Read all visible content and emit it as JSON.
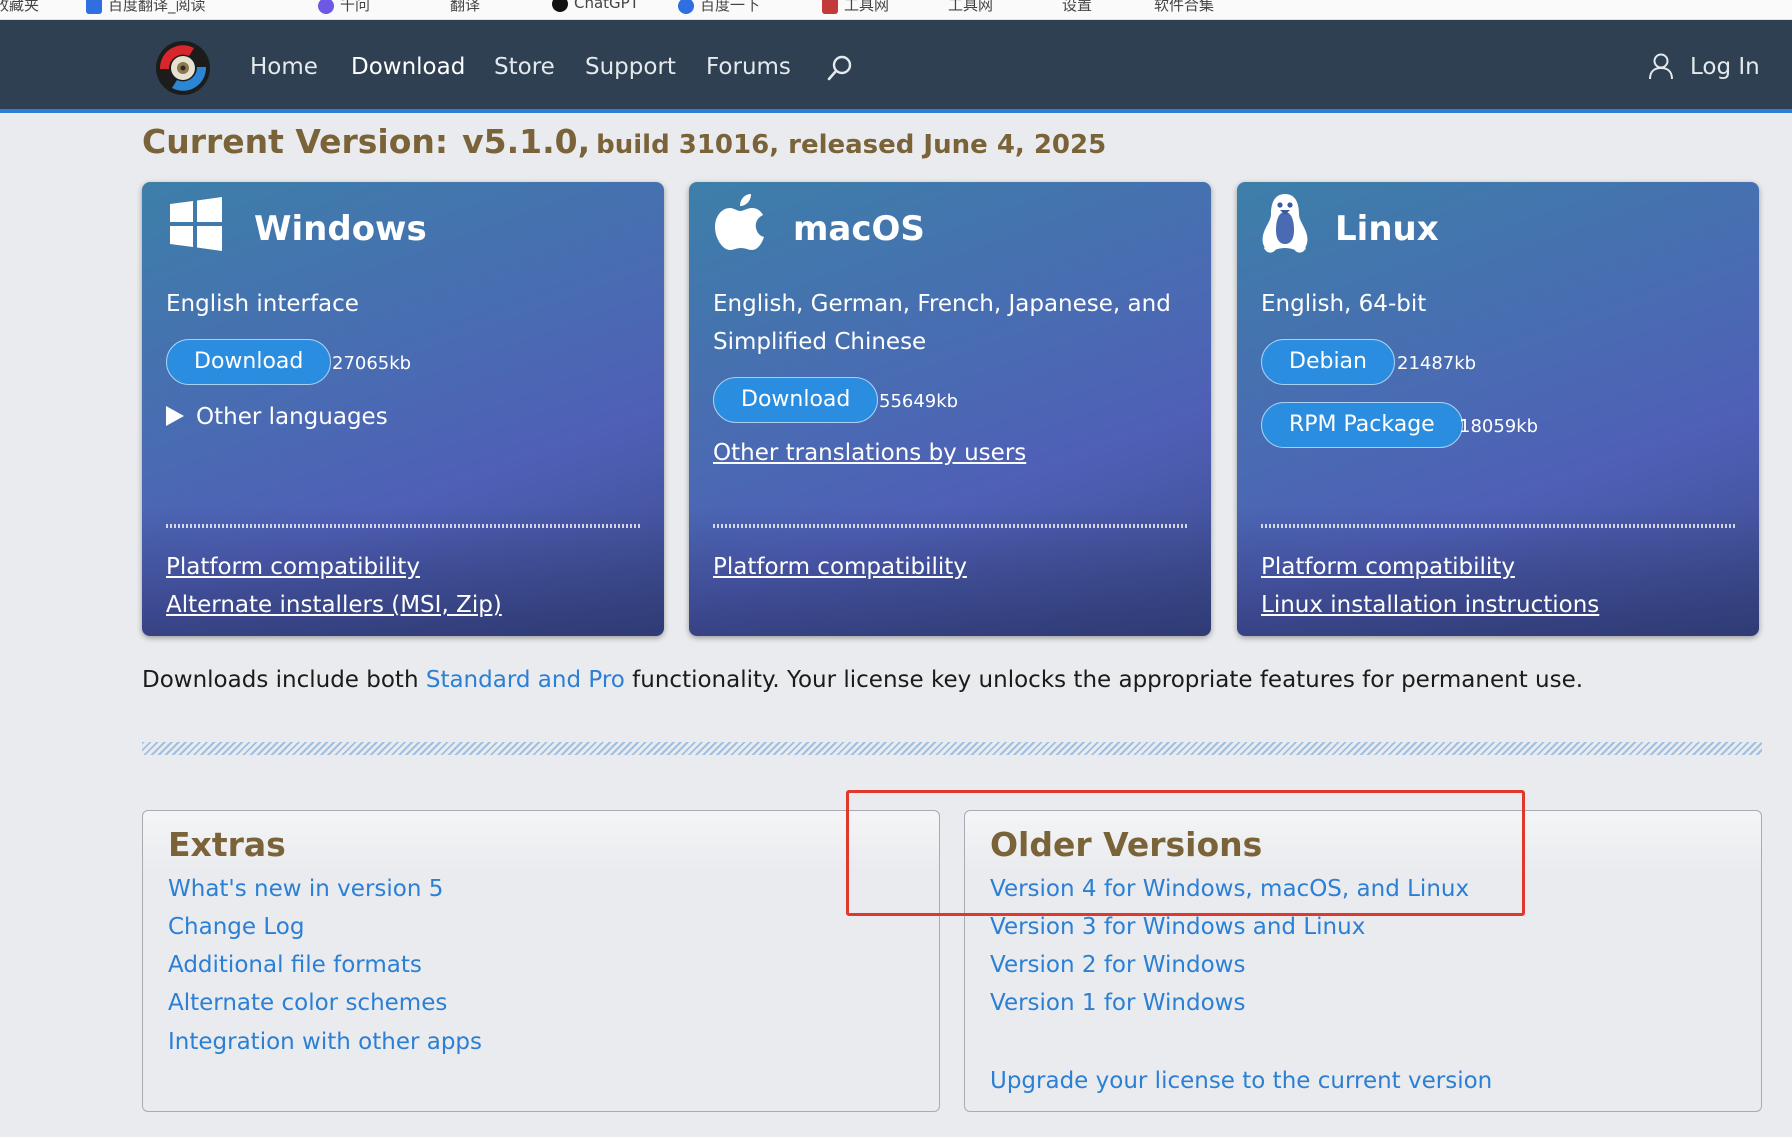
{
  "bookmarks": [
    {
      "label": "收藏夹",
      "icon": "folder-icon",
      "color": "#4a4a4a"
    },
    {
      "label": "百度翻译_阅读",
      "icon": "baidu-translate-icon",
      "color": "#2f6fe0"
    },
    {
      "label": "千问",
      "icon": "qwen-icon",
      "color": "#6b59e6"
    },
    {
      "label": "翻译",
      "icon": "translate-icon",
      "color": "#444444"
    },
    {
      "label": "ChatGPT",
      "icon": "chatgpt-icon",
      "color": "#111111"
    },
    {
      "label": "百度一下",
      "icon": "baidu-icon",
      "color": "#2f6fe0"
    },
    {
      "label": "工具网",
      "icon": "tool-site-icon",
      "color": "#c23a3a"
    },
    {
      "label": "工具网",
      "icon": "web-icon",
      "color": "#777777"
    },
    {
      "label": "设置",
      "icon": "settings-icon",
      "color": "#777777"
    },
    {
      "label": "软件合集",
      "icon": "software-icon",
      "color": "#777777"
    }
  ],
  "nav": {
    "items": [
      "Home",
      "Download",
      "Store",
      "Support",
      "Forums"
    ],
    "active": "Download",
    "login_label": "Log In"
  },
  "current_version": {
    "label": "Current Version:",
    "version": "v5.1.0,",
    "build_text": "build 31016, released June 4, 2025"
  },
  "cards": {
    "windows": {
      "title": "Windows",
      "desc": "English interface",
      "download_label": "Download",
      "download_size": "27065kb",
      "other_languages": "Other languages",
      "links": [
        "Platform compatibility",
        "Alternate installers (MSI, Zip)"
      ]
    },
    "macos": {
      "title": "macOS",
      "desc": "English, German, French, Japanese, and Simplified Chinese",
      "download_label": "Download",
      "download_size": "55649kb",
      "translations_link": "Other translations by users",
      "links": [
        "Platform compatibility"
      ]
    },
    "linux": {
      "title": "Linux",
      "desc": "English, 64-bit",
      "debian_label": "Debian",
      "debian_size": "21487kb",
      "rpm_label": "RPM Package",
      "rpm_size": "18059kb",
      "links": [
        "Platform compatibility",
        "Linux installation instructions"
      ]
    }
  },
  "info": {
    "prefix": "Downloads include both ",
    "link": "Standard and Pro",
    "suffix": " functionality.  Your license key unlocks the appropriate features for permanent use."
  },
  "extras": {
    "title": "Extras",
    "links": [
      "What's new in version 5",
      "Change Log",
      "Additional file formats",
      "Alternate color schemes",
      "Integration with other apps"
    ]
  },
  "older_versions": {
    "title": "Older Versions",
    "links": [
      "Version 4 for Windows, macOS, and Linux",
      "Version 3 for Windows and Linux",
      "Version 2 for Windows",
      "Version 1 for Windows"
    ],
    "upgrade_link": "Upgrade your license to the current version"
  },
  "colors": {
    "navbar": "#2e4051",
    "accent": "#2b7fd4",
    "heading": "#7a6338",
    "highlight": "#e0382d"
  }
}
